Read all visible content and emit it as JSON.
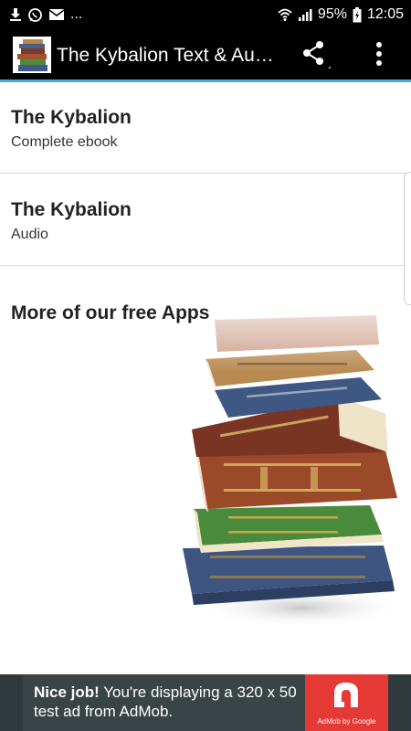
{
  "status_bar": {
    "notification_icons": [
      "download-icon",
      "whatsapp-icon",
      "mail-icon"
    ],
    "overflow_text": "...",
    "battery_percent": "95%",
    "time": "12:05"
  },
  "appbar": {
    "title": "The Kybalion Text & Audio",
    "accent_color": "#4aa8d8"
  },
  "list": {
    "items": [
      {
        "title": "The Kybalion",
        "subtitle": "Complete ebook"
      },
      {
        "title": "The Kybalion",
        "subtitle": "Audio"
      }
    ]
  },
  "more_apps": {
    "heading": "More of our free Apps"
  },
  "ad": {
    "headline": "Nice job!",
    "body": " You're displaying a 320 x 50 test ad from AdMob.",
    "attribution": "AdMob by Google",
    "brand_color": "#e53935"
  }
}
